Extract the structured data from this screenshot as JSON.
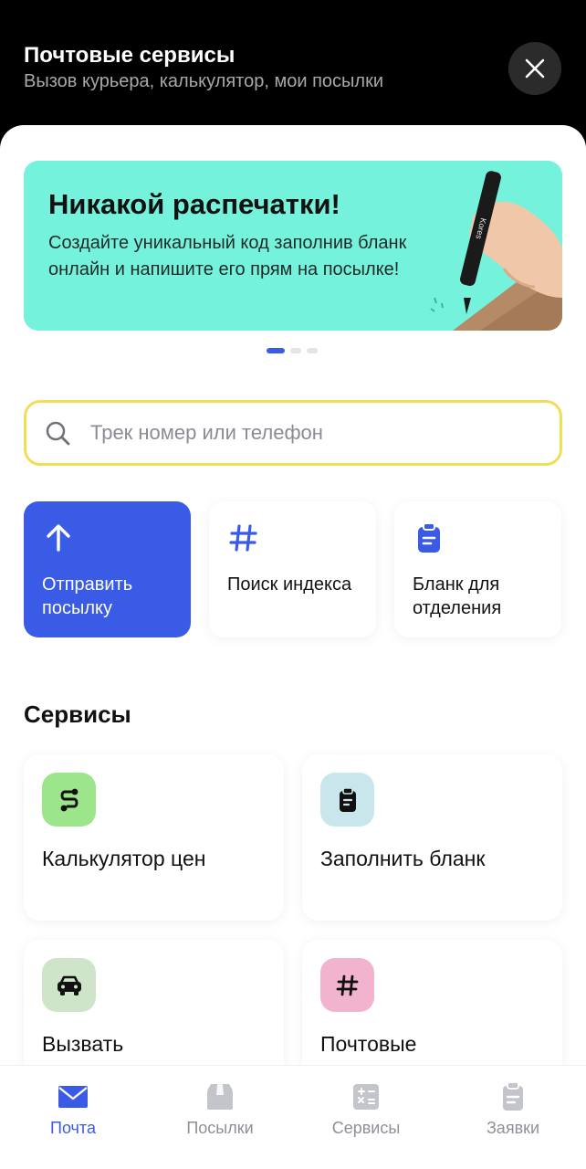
{
  "header": {
    "title": "Почтовые сервисы",
    "subtitle": "Вызов курьера, калькулятор, мои посылки",
    "close_icon": "close-icon"
  },
  "banner": {
    "title": "Никакой распечатки!",
    "text": "Создайте уникальный код заполнив бланк онлайн и напишите его прям на посылке!",
    "background": "#74f2dc",
    "pen_brand": "Kores",
    "slides_total": 3,
    "slide_active": 1
  },
  "search": {
    "placeholder": "Трек номер или телефон",
    "value": "",
    "border_color": "#f3dd58"
  },
  "quick_actions": [
    {
      "label": "Отправить посылку",
      "icon": "arrow-up-icon",
      "primary": true
    },
    {
      "label": "Поиск индекса",
      "icon": "hash-icon",
      "primary": false
    },
    {
      "label": "Бланк для отделения",
      "icon": "clipboard-icon",
      "primary": false
    }
  ],
  "services": {
    "title": "Сервисы",
    "items": [
      {
        "label": "Калькулятор цен",
        "icon": "route-icon",
        "icon_bg": "#9de58a"
      },
      {
        "label": "Заполнить бланк",
        "icon": "clipboard-icon",
        "icon_bg": "#c9e6ec"
      },
      {
        "label": "Вызвать",
        "icon": "car-icon",
        "icon_bg": "#cfe5c9"
      },
      {
        "label": "Почтовые",
        "icon": "hash-icon",
        "icon_bg": "#f2b3ce"
      }
    ]
  },
  "tabbar": {
    "items": [
      {
        "label": "Почта",
        "icon": "mail-icon",
        "active": true
      },
      {
        "label": "Посылки",
        "icon": "package-icon",
        "active": false
      },
      {
        "label": "Сервисы",
        "icon": "calculator-icon",
        "active": false
      },
      {
        "label": "Заявки",
        "icon": "clipboard-icon",
        "active": false
      }
    ]
  },
  "colors": {
    "accent": "#3a5be6",
    "inactive": "#8e9097"
  }
}
